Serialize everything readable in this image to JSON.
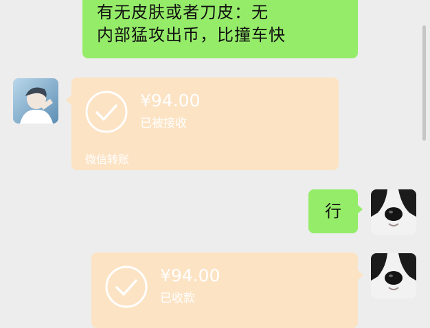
{
  "messages": [
    {
      "id": "msg1",
      "type": "text",
      "side": "right",
      "text": "有无皮肤或者刀皮：无\n内部猛攻出币，比撞车快"
    },
    {
      "id": "msg2",
      "type": "transfer",
      "side": "left",
      "amount": "¥94.00",
      "status": "已被接收",
      "footer": "微信转账"
    },
    {
      "id": "msg3",
      "type": "text",
      "side": "right",
      "text": "行"
    },
    {
      "id": "msg4",
      "type": "transfer",
      "side": "right",
      "amount": "¥94.00",
      "status": "已收款"
    }
  ],
  "colors": {
    "background": "#ededed",
    "sent_bubble": "#95ec69",
    "transfer_bubble": "#fce3c4"
  },
  "icons": {
    "transfer_status": "check-circle-icon",
    "left_avatar": "user-avatar",
    "right_avatar": "dog-avatar"
  }
}
